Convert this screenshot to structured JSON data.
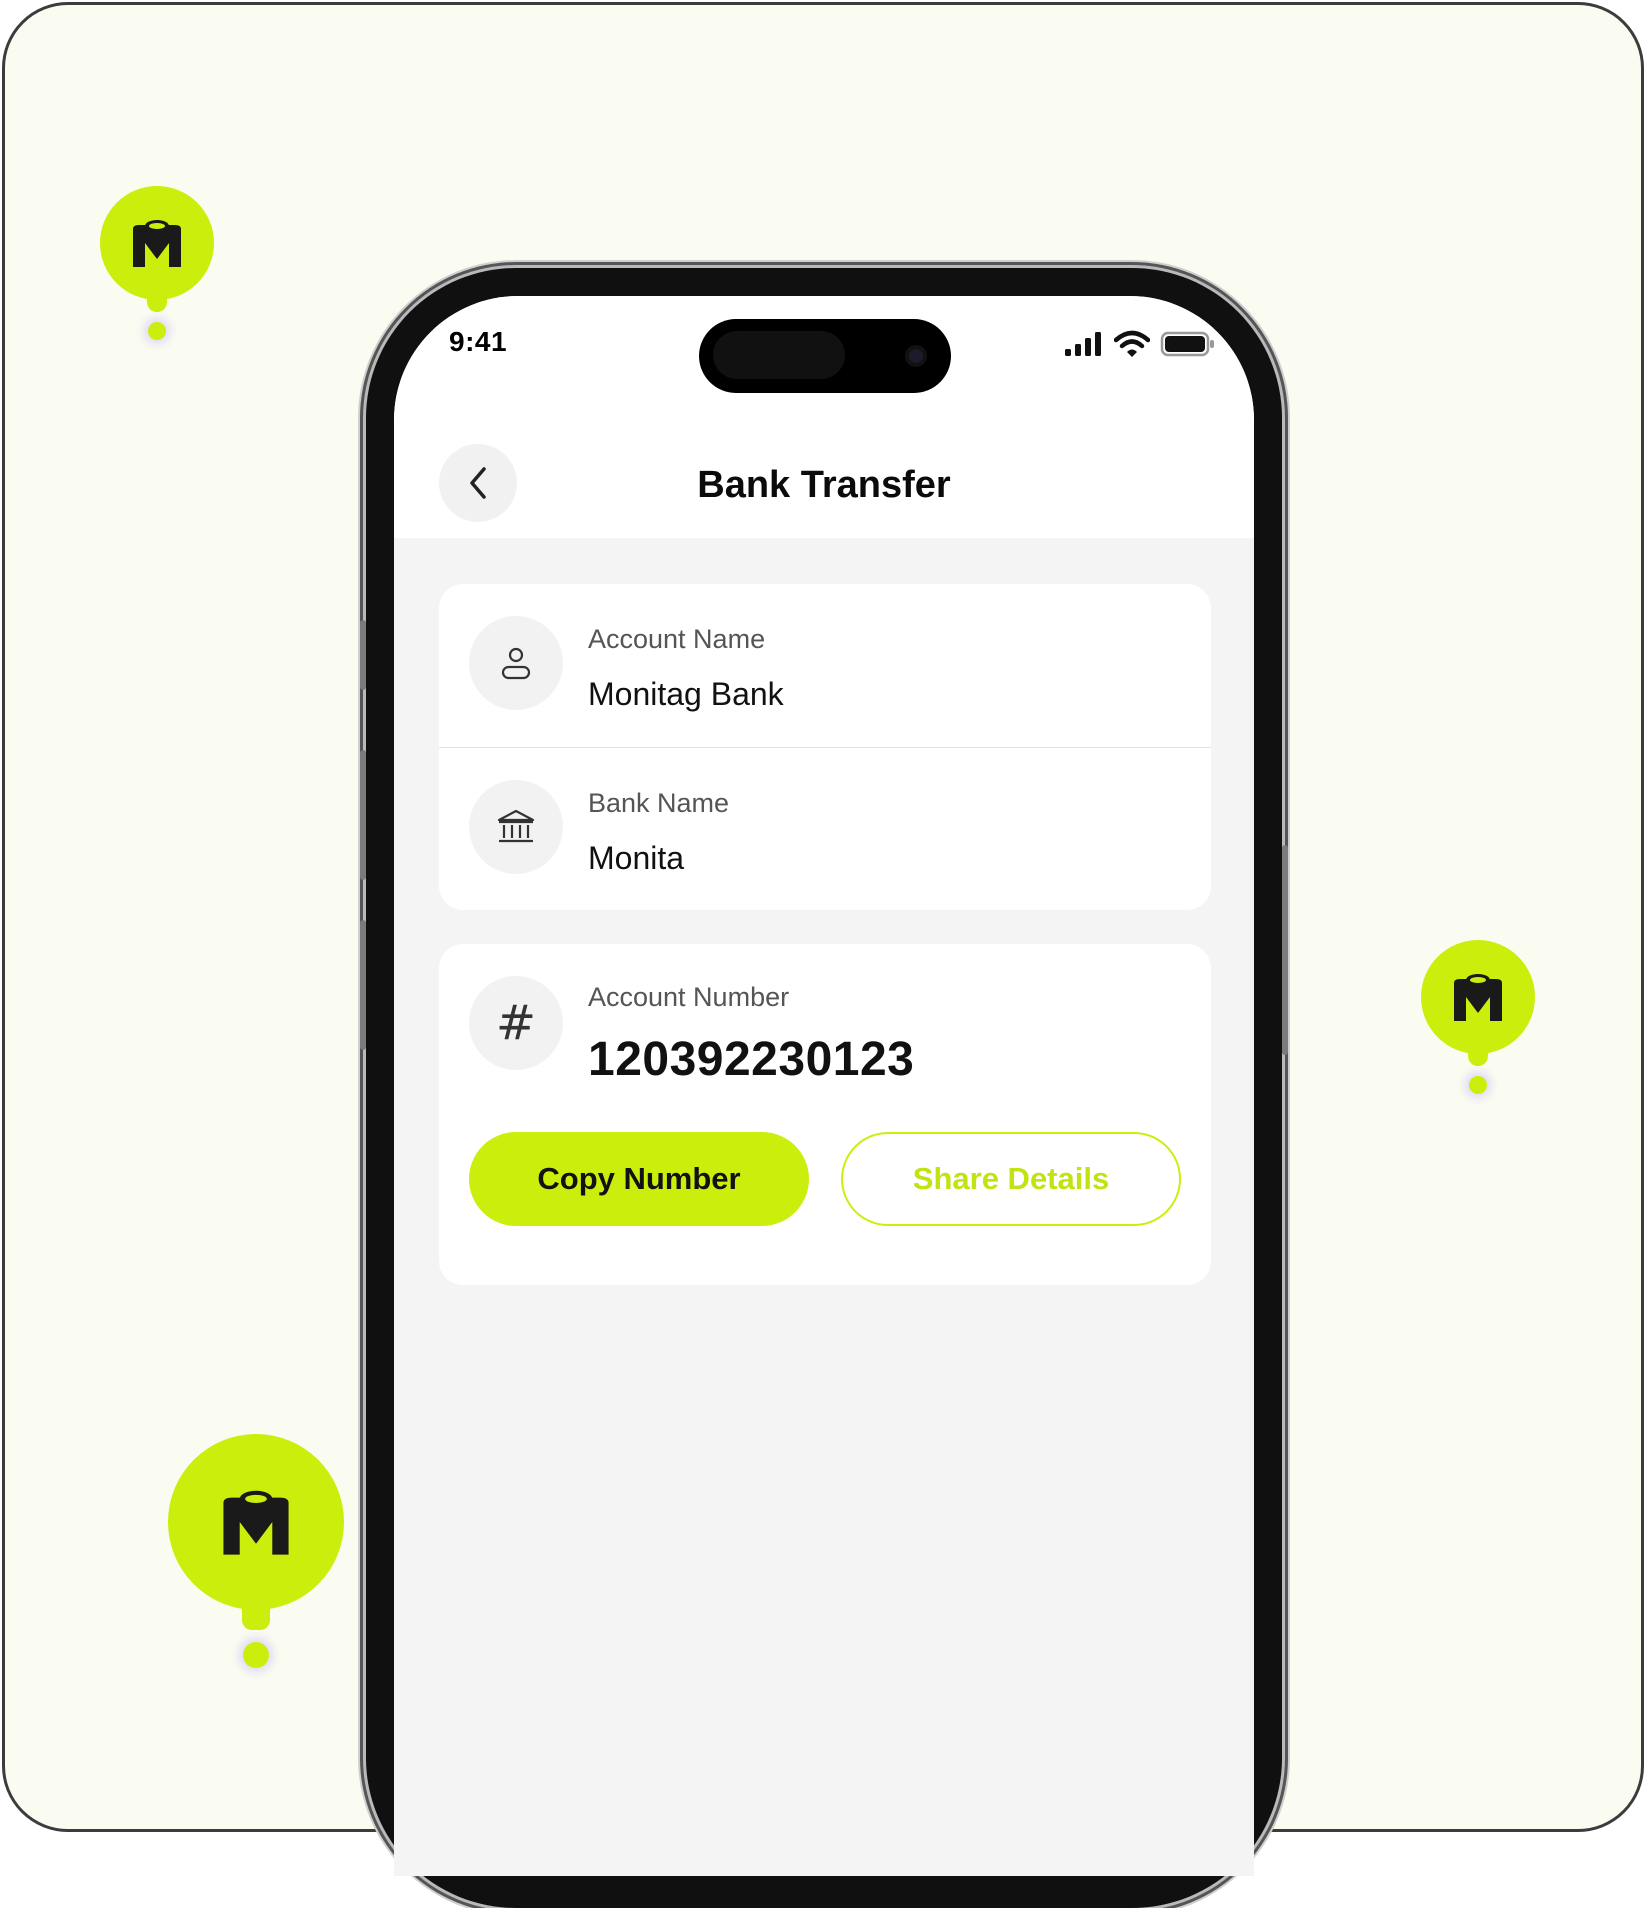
{
  "colors": {
    "accent": "#cbee0d",
    "background": "#fbfcf1",
    "title_text": "#0b0b0b"
  },
  "status_bar": {
    "time": "9:41",
    "icons": [
      "signal-icon",
      "wifi-icon",
      "battery-icon"
    ]
  },
  "header": {
    "title": "Bank Transfer",
    "back_icon": "chevron-left-icon"
  },
  "details": {
    "account_name": {
      "label": "Account Name",
      "value": "Monitag Bank",
      "icon": "user-icon"
    },
    "bank_name": {
      "label": "Bank Name",
      "value": "Monita",
      "icon": "bank-icon"
    }
  },
  "account_number": {
    "label": "Account Number",
    "value": "120392230123",
    "icon": "hash-icon"
  },
  "actions": {
    "copy_label": "Copy Number",
    "share_label": "Share Details"
  },
  "decor": {
    "logo_icon": "monitag-logo-icon"
  }
}
